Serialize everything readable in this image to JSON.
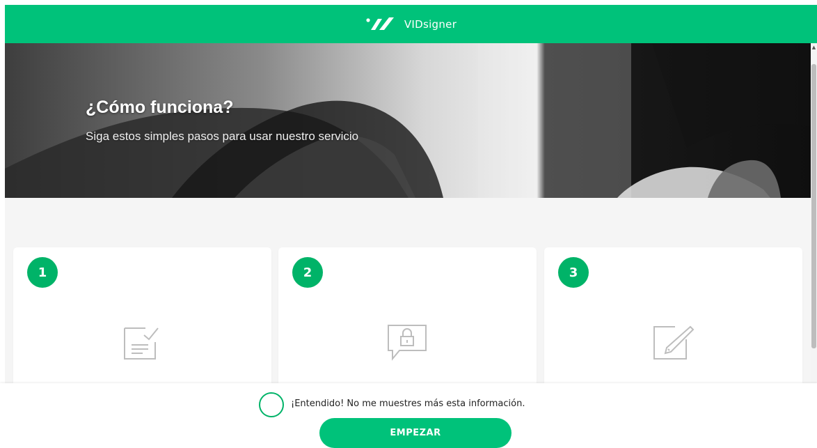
{
  "brand": {
    "name": "VIDsigner"
  },
  "hero": {
    "title": "¿Cómo funciona?",
    "subtitle": "Siga estos simples pasos para usar nuestro servicio"
  },
  "steps": [
    {
      "number": "1",
      "icon": "document-check-icon"
    },
    {
      "number": "2",
      "icon": "lock-message-icon"
    },
    {
      "number": "3",
      "icon": "edit-pen-icon"
    }
  ],
  "consent": {
    "label": "¡Entendido! No me muestres más esta información.",
    "checked": false
  },
  "actions": {
    "start_label": "EMPEZAR"
  },
  "colors": {
    "brand_green": "#00c27a",
    "badge_green": "#00b368",
    "step_bg": "#f5f5f5"
  }
}
